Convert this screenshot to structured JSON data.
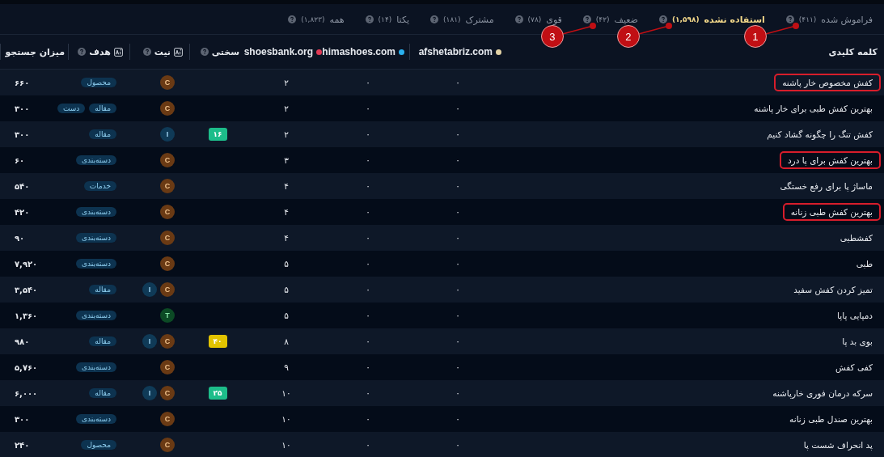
{
  "tabs": [
    {
      "label": "فراموش شده",
      "count": "(۴۱۱)",
      "selected": false,
      "callout": "1"
    },
    {
      "label": "استفاده نشده",
      "count": "(۱,۵۹۸)",
      "selected": true,
      "callout": "2"
    },
    {
      "label": "ضعیف",
      "count": "(۴۲)",
      "selected": false,
      "callout": "3"
    },
    {
      "label": "قوی",
      "count": "(۷۸)",
      "selected": false
    },
    {
      "label": "مشترک",
      "count": "(۱۸۱)",
      "selected": false
    },
    {
      "label": "یکتا",
      "count": "(۱۴)",
      "selected": false
    },
    {
      "label": "همه",
      "count": "(۱,۸۲۳)",
      "selected": false
    }
  ],
  "columns": {
    "keyword": "کلمه کلیدی",
    "competitors": [
      {
        "domain": "afshetabriz.com",
        "color": "#e3d3a6"
      },
      {
        "domain": "himashoes.com",
        "color": "#2ab0ee"
      },
      {
        "domain": "shoesbank.org",
        "color": "#e23a55"
      }
    ],
    "difficulty": "سختی",
    "intent": "نیت",
    "target": "هدف",
    "volume": "میزان جستجو"
  },
  "rows": [
    {
      "keyword": "کفش مخصوص خار پاشنه",
      "highlighted": true,
      "competitors": [
        "۰",
        "۰",
        "۲"
      ],
      "intents": [
        {
          "kind": "commercial",
          "letter": "C"
        }
      ],
      "targets": [
        "محصول"
      ],
      "volume": "۶۶۰"
    },
    {
      "keyword": "بهترین کفش طبی برای خار پاشنه",
      "highlighted": false,
      "competitors": [
        "۰",
        "۰",
        "۲"
      ],
      "intents": [
        {
          "kind": "commercial",
          "letter": "C"
        }
      ],
      "targets": [
        "مقاله",
        "دست"
      ],
      "volume": "۳۰۰"
    },
    {
      "keyword": "کفش تنگ را چگونه گشاد کنیم",
      "highlighted": false,
      "competitors": [
        "۰",
        "۰",
        "۲"
      ],
      "difficulty": {
        "value": "۱۶",
        "color": "#1dbd8a"
      },
      "intents": [
        {
          "kind": "informational",
          "letter": "I"
        }
      ],
      "targets": [
        "مقاله"
      ],
      "volume": "۳۰۰"
    },
    {
      "keyword": "بهترین کفش برای پا درد",
      "highlighted": true,
      "competitors": [
        "۰",
        "۰",
        "۳"
      ],
      "intents": [
        {
          "kind": "commercial",
          "letter": "C"
        }
      ],
      "targets": [
        "دسته‌بندی"
      ],
      "volume": "۶۰"
    },
    {
      "keyword": "ماساژ پا برای رفع خستگی",
      "highlighted": false,
      "competitors": [
        "۰",
        "۰",
        "۴"
      ],
      "intents": [
        {
          "kind": "commercial",
          "letter": "C"
        }
      ],
      "targets": [
        "خدمات"
      ],
      "volume": "۵۴۰"
    },
    {
      "keyword": "بهترین کفش طبی زنانه",
      "highlighted": true,
      "competitors": [
        "۰",
        "۰",
        "۴"
      ],
      "intents": [
        {
          "kind": "commercial",
          "letter": "C"
        }
      ],
      "targets": [
        "دسته‌بندی"
      ],
      "volume": "۴۲۰"
    },
    {
      "keyword": "کفشطبی",
      "highlighted": false,
      "competitors": [
        "۰",
        "۰",
        "۴"
      ],
      "intents": [
        {
          "kind": "commercial",
          "letter": "C"
        }
      ],
      "targets": [
        "دسته‌بندی"
      ],
      "volume": "۹۰"
    },
    {
      "keyword": "طبی",
      "highlighted": false,
      "competitors": [
        "۰",
        "۰",
        "۵"
      ],
      "intents": [
        {
          "kind": "commercial",
          "letter": "C"
        }
      ],
      "targets": [
        "دسته‌بندی"
      ],
      "volume": "۷,۹۲۰"
    },
    {
      "keyword": "تمیز کردن کفش سفید",
      "highlighted": false,
      "competitors": [
        "۰",
        "۰",
        "۵"
      ],
      "intents": [
        {
          "kind": "commercial",
          "letter": "C"
        },
        {
          "kind": "informational",
          "letter": "I"
        }
      ],
      "targets": [
        "مقاله"
      ],
      "volume": "۳,۵۴۰"
    },
    {
      "keyword": "دمپایی پاپا",
      "highlighted": false,
      "competitors": [
        "۰",
        "۰",
        "۵"
      ],
      "intents": [
        {
          "kind": "transactional",
          "letter": "T"
        }
      ],
      "targets": [
        "دسته‌بندی"
      ],
      "volume": "۱,۳۶۰"
    },
    {
      "keyword": "بوی بد پا",
      "highlighted": false,
      "competitors": [
        "۰",
        "۰",
        "۸"
      ],
      "difficulty": {
        "value": "۴۰",
        "color": "#e2c300"
      },
      "intents": [
        {
          "kind": "commercial",
          "letter": "C"
        },
        {
          "kind": "informational",
          "letter": "I"
        }
      ],
      "targets": [
        "مقاله"
      ],
      "volume": "۹۸۰"
    },
    {
      "keyword": "کفی کفش",
      "highlighted": false,
      "competitors": [
        "۰",
        "۰",
        "۹"
      ],
      "intents": [
        {
          "kind": "commercial",
          "letter": "C"
        }
      ],
      "targets": [
        "دسته‌بندی"
      ],
      "volume": "۵,۷۶۰"
    },
    {
      "keyword": "سرکه درمان فوری خارپاشنه",
      "highlighted": false,
      "competitors": [
        "۰",
        "۰",
        "۱۰"
      ],
      "difficulty": {
        "value": "۲۵",
        "color": "#1dbd8a"
      },
      "intents": [
        {
          "kind": "commercial",
          "letter": "C"
        },
        {
          "kind": "informational",
          "letter": "I"
        }
      ],
      "targets": [
        "مقاله"
      ],
      "volume": "۶,۰۰۰"
    },
    {
      "keyword": "بهترین صندل طبی زنانه",
      "highlighted": false,
      "competitors": [
        "۰",
        "۰",
        "۱۰"
      ],
      "intents": [
        {
          "kind": "commercial",
          "letter": "C"
        }
      ],
      "targets": [
        "دسته‌بندی"
      ],
      "volume": "۳۰۰"
    },
    {
      "keyword": "پد انحراف شست پا",
      "highlighted": false,
      "competitors": [
        "۰",
        "۰",
        "۱۰"
      ],
      "intents": [
        {
          "kind": "commercial",
          "letter": "C"
        }
      ],
      "targets": [
        "محصول"
      ],
      "volume": "۲۴۰"
    }
  ]
}
